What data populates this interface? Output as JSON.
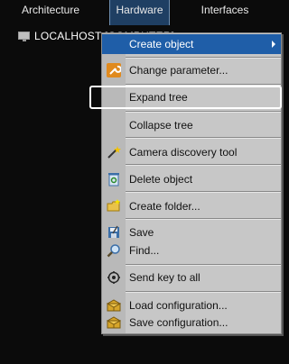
{
  "tabs": [
    {
      "label": "Architecture",
      "active": false
    },
    {
      "label": "Hardware",
      "active": true
    },
    {
      "label": "Interfaces",
      "active": false
    }
  ],
  "tree": {
    "root_label": "LOCALHOST [COMPUTER]",
    "root_icon": "computer-icon"
  },
  "context_menu": {
    "items": [
      {
        "label": "Create object",
        "icon": null,
        "submenu": true,
        "highlighted": true
      },
      {
        "label": "Change parameter...",
        "icon": "wrench-icon"
      },
      {
        "label": "Expand tree",
        "icon": null
      },
      {
        "label": "Collapse tree",
        "icon": null
      },
      {
        "label": "Camera discovery tool",
        "icon": "magic-wand-icon"
      },
      {
        "label": "Delete object",
        "icon": "recycle-bin-icon"
      },
      {
        "label": "Create folder...",
        "icon": "folder-icon"
      },
      {
        "label": "Save",
        "icon": "save-icon"
      },
      {
        "label": "Find...",
        "icon": "magnifier-icon"
      },
      {
        "label": "Send key to all",
        "icon": "key-icon"
      },
      {
        "label": "Load configuration...",
        "icon": "load-box-icon"
      },
      {
        "label": "Save configuration...",
        "icon": "save-box-icon"
      }
    ]
  },
  "colors": {
    "background": "#0b0b0b",
    "active_tab": "#1f3f63",
    "menu_bg": "#c7c7c7",
    "menu_highlight": "#1f5ea8",
    "callout_border": "#ffffff"
  }
}
